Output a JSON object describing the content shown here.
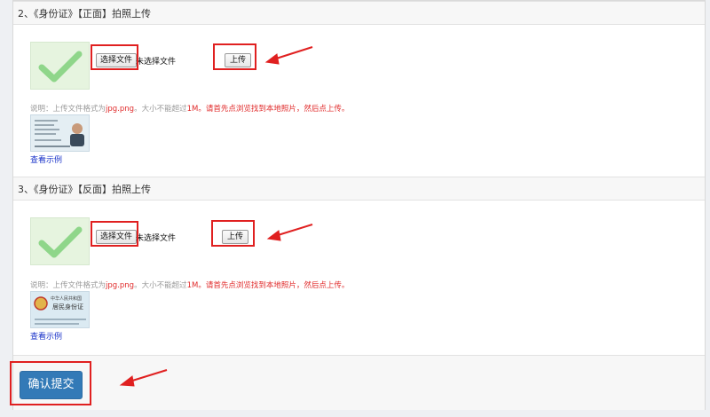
{
  "sections": [
    {
      "title": "2、《身份证》【正面】拍照上传",
      "file_button": "选择文件",
      "file_status": "未选择文件",
      "upload_button": "上传",
      "note_prefix": "说明：上传文件格式为",
      "note_formats": "jpg.png",
      "note_mid": "。大小不能超过",
      "note_size": "1M",
      "note_suffix": "。请首先点浏览找到本地照片，然后点上传。",
      "sample_link": "查看示例"
    },
    {
      "title": "3、《身份证》【反面】拍照上传",
      "file_button": "选择文件",
      "file_status": "未选择文件",
      "upload_button": "上传",
      "note_prefix": "说明：上传文件格式为",
      "note_formats": "jpg.png",
      "note_mid": "。大小不能超过",
      "note_size": "1M",
      "note_suffix": "。请首先点浏览找到本地照片，然后点上传。",
      "sample_link": "查看示例",
      "sample_text_line1": "中华人民共和国",
      "sample_text_line2": "居民身份证"
    }
  ],
  "submit_button": "确认提交",
  "colors": {
    "annotation_red": "#e02020",
    "primary_blue": "#337ab7",
    "link_blue": "#1a33c9",
    "check_green": "#8fd68a"
  }
}
